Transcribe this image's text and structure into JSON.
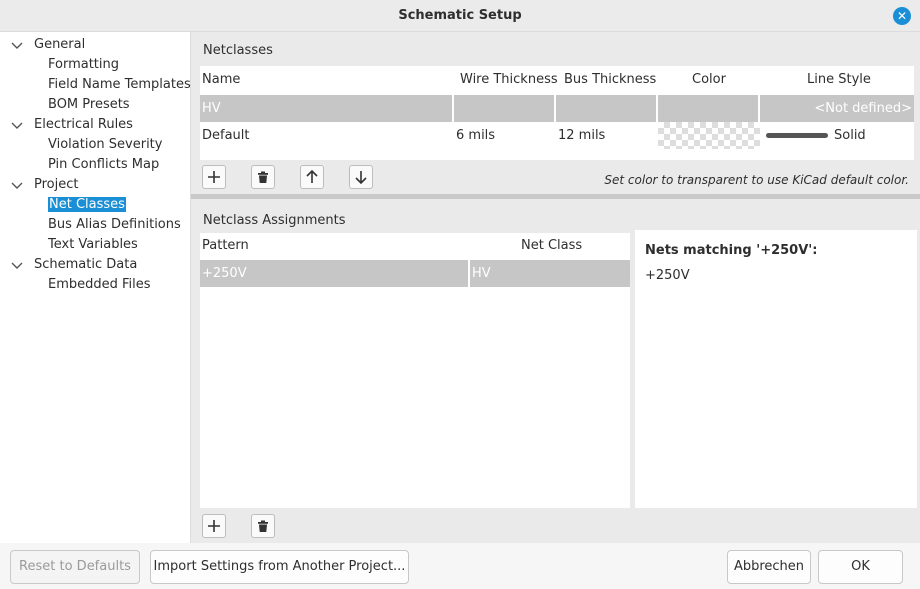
{
  "window": {
    "title": "Schematic Setup"
  },
  "sidebar": {
    "items": [
      {
        "label": "General",
        "level": 0
      },
      {
        "label": "Formatting",
        "level": 1
      },
      {
        "label": "Field Name Templates",
        "level": 1
      },
      {
        "label": "BOM Presets",
        "level": 1
      },
      {
        "label": "Electrical Rules",
        "level": 0
      },
      {
        "label": "Violation Severity",
        "level": 1
      },
      {
        "label": "Pin Conflicts Map",
        "level": 1
      },
      {
        "label": "Project",
        "level": 0
      },
      {
        "label": "Net Classes",
        "level": 1,
        "selected": true
      },
      {
        "label": "Bus Alias Definitions",
        "level": 1
      },
      {
        "label": "Text Variables",
        "level": 1
      },
      {
        "label": "Schematic Data",
        "level": 0
      },
      {
        "label": "Embedded Files",
        "level": 1
      }
    ]
  },
  "netclasses": {
    "title": "Netclasses",
    "columns": [
      "Name",
      "Wire Thickness",
      "Bus Thickness",
      "Color",
      "Line Style"
    ],
    "rows": [
      {
        "name": "HV",
        "wire": "",
        "bus": "",
        "line_style": "<Not defined>"
      },
      {
        "name": "Default",
        "wire": "6 mils",
        "bus": "12 mils",
        "line_style": "Solid"
      }
    ],
    "hint": "Set color to transparent to use KiCad default color."
  },
  "assignments": {
    "title": "Netclass Assignments",
    "columns": [
      "Pattern",
      "Net Class"
    ],
    "rows": [
      {
        "pattern": "+250V",
        "net_class": "HV"
      }
    ]
  },
  "matching": {
    "title": "Nets matching '+250V':",
    "nets": [
      "+250V"
    ]
  },
  "footer": {
    "reset_label": "Reset to Defaults",
    "import_label": "Import Settings from Another Project...",
    "cancel_label": "Abbrechen",
    "ok_label": "OK"
  },
  "colors": {
    "accent": "#1a8fd6",
    "selected_row": "#c6c6c6"
  }
}
